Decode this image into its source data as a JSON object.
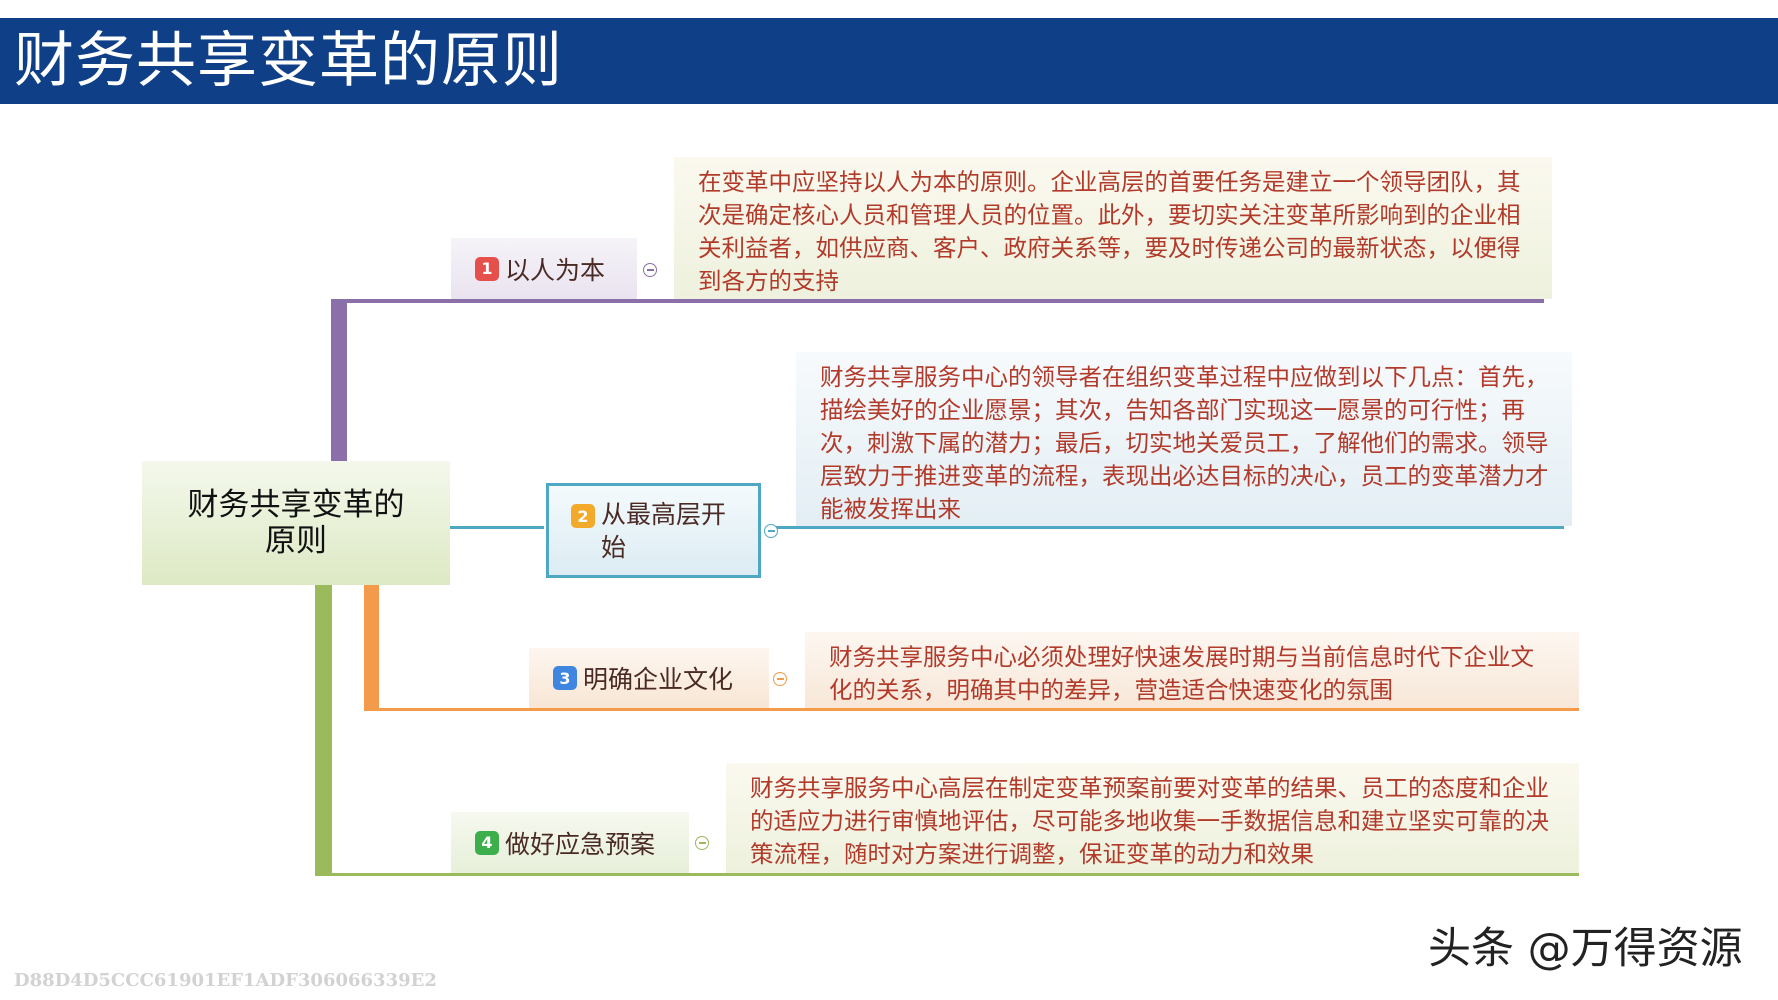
{
  "title": "财务共享变革的原则",
  "colors": {
    "header_bg": "#0f3f86",
    "branch1": "#8b6fa8",
    "branch2": "#4ea8c4",
    "branch3": "#f39a4b",
    "branch4": "#9aba5c",
    "badge1": "#e5504c",
    "badge2": "#f3aa2a",
    "badge3": "#3e86e0",
    "badge4": "#3cae4c"
  },
  "root": {
    "label": "财务共享变革的原则"
  },
  "branches": [
    {
      "number": "1",
      "label": "以人为本",
      "description": "在变革中应坚持以人为本的原则。企业高层的首要任务是建立一个领导团队，其次是确定核心人员和管理人员的位置。此外，要切实关注变革所影响到的企业相关利益者，如供应商、客户、政府关系等，要及时传递公司的最新状态，以便得到各方的支持"
    },
    {
      "number": "2",
      "label": "从最高层开始",
      "description": "财务共享服务中心的领导者在组织变革过程中应做到以下几点：首先，描绘美好的企业愿景；其次，告知各部门实现这一愿景的可行性；再次，刺激下属的潜力；最后，切实地关爱员工，了解他们的需求。领导层致力于推进变革的流程，表现出必达目标的决心，员工的变革潜力才能被发挥出来"
    },
    {
      "number": "3",
      "label": "明确企业文化",
      "description": "财务共享服务中心必须处理好快速发展时期与当前信息时代下企业文化的关系，明确其中的差异，营造适合快速变化的氛围"
    },
    {
      "number": "4",
      "label": "做好应急预案",
      "description": "财务共享服务中心高层在制定变革预案前要对变革的结果、员工的态度和企业的适应力进行审慎地评估，尽可能多地收集一手数据信息和建立坚实可靠的决策流程，随时对方案进行调整，保证变革的动力和效果"
    }
  ],
  "watermark": "D88D4D5CCC61901EF1ADF306066339E2",
  "logo": "头条 @万得资源"
}
